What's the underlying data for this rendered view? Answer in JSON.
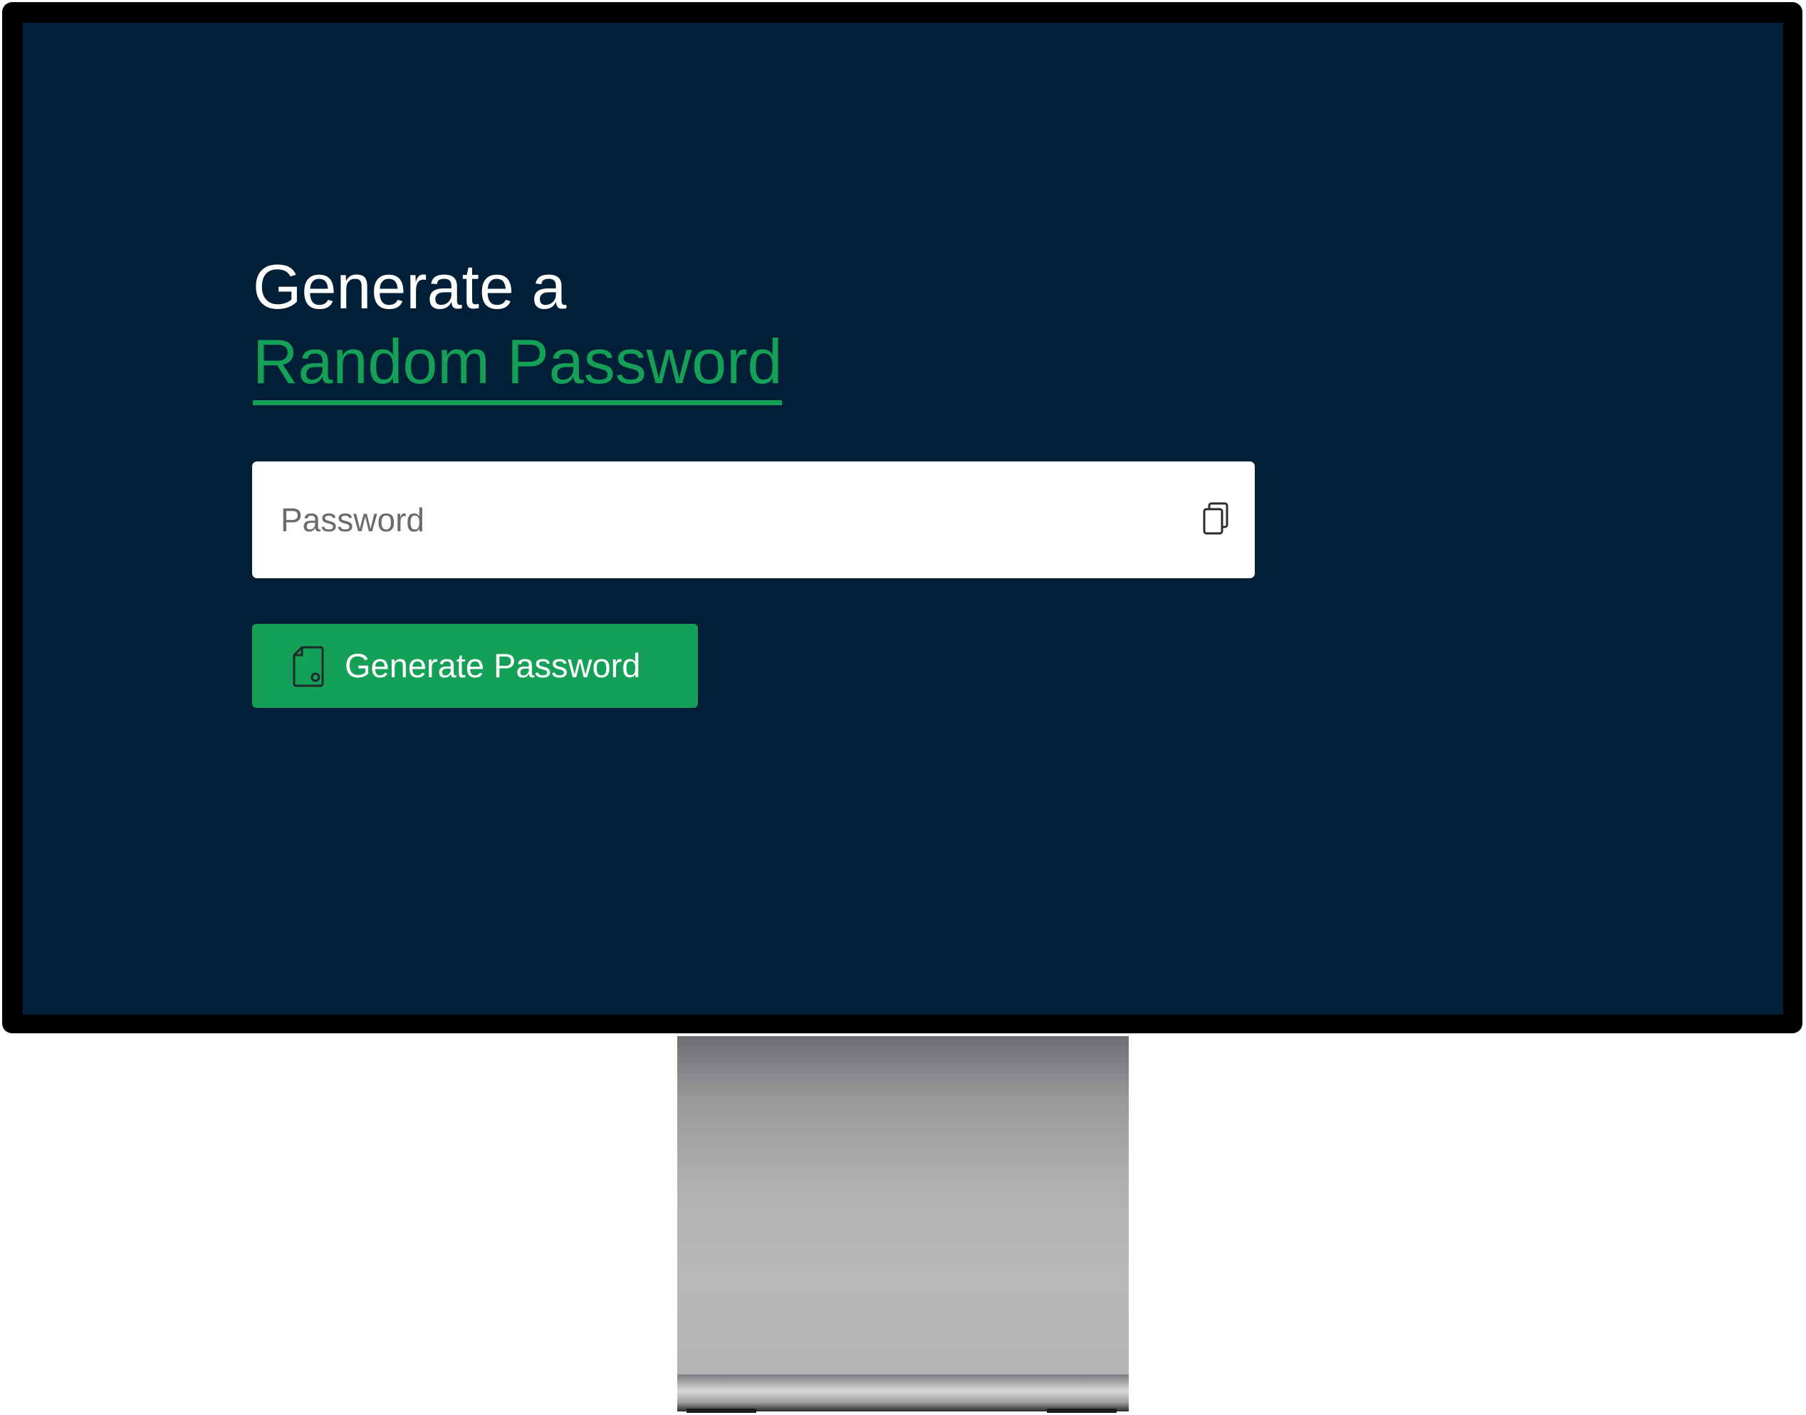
{
  "app": {
    "heading_line1": "Generate a",
    "heading_line2": "Random Password"
  },
  "password_field": {
    "value": "",
    "placeholder": "Password",
    "copy_icon": "copy-icon"
  },
  "generate_button": {
    "label": "Generate Password",
    "icon": "document-key-icon"
  },
  "colors": {
    "screen_background": "#012038",
    "accent": "#14a157",
    "heading_text": "#ffffff",
    "input_background": "#ffffff"
  }
}
